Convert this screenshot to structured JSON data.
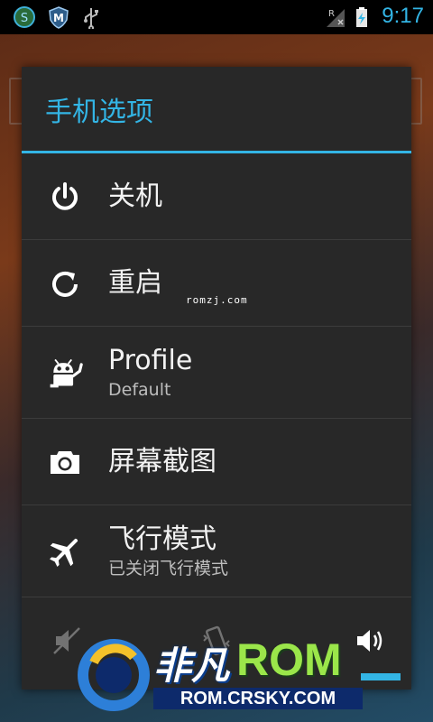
{
  "status_bar": {
    "time": "9:17",
    "icons": [
      "antivirus-icon",
      "shield-m-icon",
      "usb-icon",
      "no-signal-roaming-icon",
      "battery-charging-icon"
    ],
    "signal_label": "R"
  },
  "dialog": {
    "title": "手机选项",
    "items": [
      {
        "label": "关机",
        "icon": "power-icon"
      },
      {
        "label": "重启",
        "icon": "restart-icon"
      },
      {
        "label": "Profile",
        "sublabel": "Default",
        "icon": "profile-android-icon"
      },
      {
        "label": "屏幕截图",
        "icon": "camera-icon"
      },
      {
        "label": "飞行模式",
        "sublabel": "已关闭飞行模式",
        "icon": "airplane-icon"
      }
    ],
    "sound_modes": [
      "mute-icon",
      "vibrate-icon",
      "sound-on-icon"
    ]
  },
  "watermark": {
    "small_text": "romzj.com",
    "logo_cn": "非凡",
    "logo_rom": "ROM",
    "logo_url": "ROM.CRSKY.COM"
  },
  "colors": {
    "accent": "#33b5e5",
    "dialog_bg": "#282828",
    "logo_green": "#9be64a"
  }
}
